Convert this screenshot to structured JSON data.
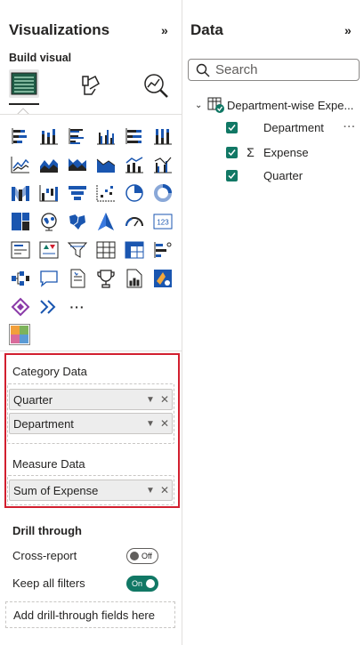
{
  "visualizations": {
    "title": "Visualizations",
    "collapse_icon": "double-chevron-right",
    "build_visual_label": "Build visual",
    "modes": [
      "build-visual-icon",
      "format-visual-icon",
      "analytics-icon"
    ],
    "visual_icons": [
      "stacked-bar-chart",
      "stacked-column-chart",
      "clustered-bar-chart",
      "clustered-column-chart",
      "100-stacked-bar-chart",
      "100-stacked-column-chart",
      "line-chart",
      "stacked-area-chart",
      "100-stacked-area-chart",
      "area-chart",
      "line-stacked-column-chart",
      "line-clustered-column-chart",
      "ribbon-chart",
      "waterfall-chart",
      "funnel-chart",
      "scatter-chart",
      "pie-chart",
      "donut-chart",
      "treemap",
      "map",
      "filled-map",
      "azure-map",
      "gauge",
      "card",
      "multi-row-card",
      "kpi",
      "slicer",
      "table",
      "matrix",
      "decomposition-tree",
      "key-influencers",
      "qna",
      "smart-narrative",
      "metrics",
      "paginated-report",
      "power-apps",
      "power-automate",
      "power-automate-alt",
      "more"
    ],
    "more_label": "···",
    "custom_visual_icon": "custom-visual-icon",
    "category_data_label": "Category Data",
    "category_fields": [
      {
        "name": "Quarter"
      },
      {
        "name": "Department"
      }
    ],
    "measure_data_label": "Measure Data",
    "measure_fields": [
      {
        "name": "Sum of Expense"
      }
    ],
    "drill_through": {
      "title": "Drill through",
      "cross_report_label": "Cross-report",
      "cross_report_state": "Off",
      "keep_filters_label": "Keep all filters",
      "keep_filters_state": "On",
      "add_fields_label": "Add drill-through fields here"
    }
  },
  "data_pane": {
    "title": "Data",
    "collapse_icon": "double-chevron-right",
    "search_placeholder": "Search",
    "table_name": "Department-wise Expe...",
    "fields": [
      {
        "name": "Department",
        "checked": true,
        "sigma": false
      },
      {
        "name": "Expense",
        "checked": true,
        "sigma": true
      },
      {
        "name": "Quarter",
        "checked": true,
        "sigma": false
      }
    ],
    "more_label": "···"
  },
  "colors": {
    "accent": "#117865",
    "highlight_border": "#d21f2f",
    "icon_blue": "#1a56b0",
    "icon_dark": "#252423"
  }
}
